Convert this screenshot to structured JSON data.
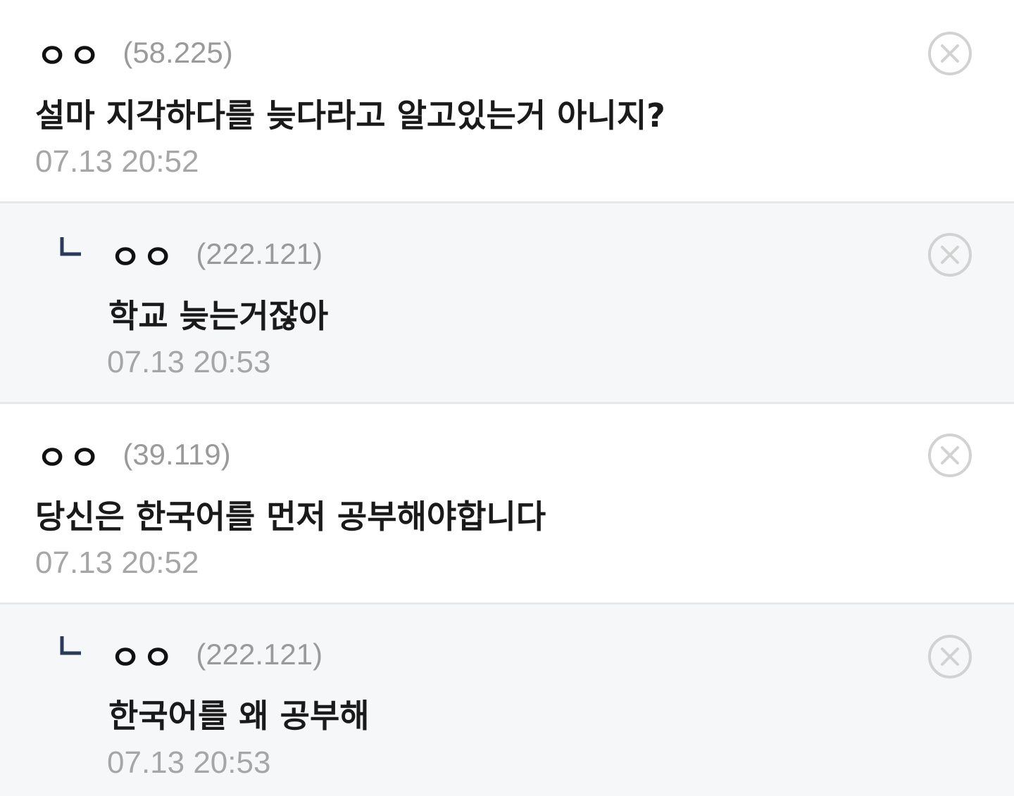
{
  "comments": [
    {
      "nickname": "ㅇㅇ",
      "ip": "(58.225)",
      "text": "설마 지각하다를 늦다라고 알고있는거 아니지?",
      "date": "07.13 20:52"
    },
    {
      "nickname": "ㅇㅇ",
      "ip": "(222.121)",
      "text": "학교 늦는거잖아",
      "date": "07.13 20:53"
    },
    {
      "nickname": "ㅇㅇ",
      "ip": "(39.119)",
      "text": "당신은 한국어를 먼저 공부해야합니다",
      "date": "07.13 20:52"
    },
    {
      "nickname": "ㅇㅇ",
      "ip": "(222.121)",
      "text": "한국어를 왜 공부해",
      "date": "07.13 20:53"
    }
  ],
  "icons": {
    "delete": "close-circle-icon",
    "reply": "reply-arrow-icon"
  },
  "colors": {
    "reply_background": "#f6f7f9",
    "divider": "#e6e8eb",
    "reply_icon": "#2a3a5c",
    "muted_text": "#a6a6a6"
  }
}
